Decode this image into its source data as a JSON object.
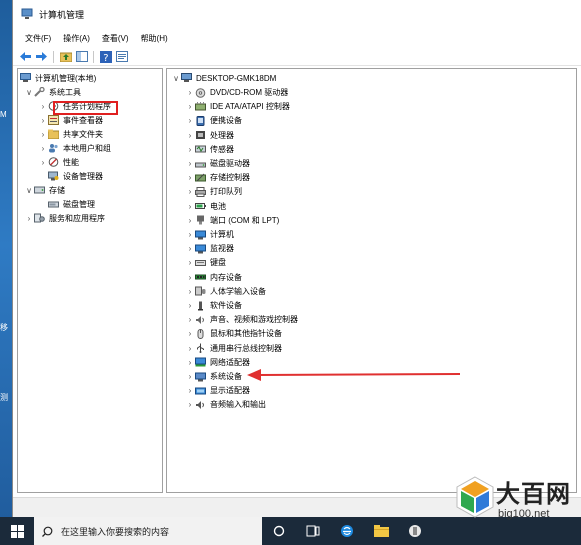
{
  "window": {
    "title": "计算机管理"
  },
  "menu": [
    "文件(F)",
    "操作(A)",
    "查看(V)",
    "帮助(H)"
  ],
  "left_tree": [
    {
      "label": "计算机管理(本地)",
      "indent": 0,
      "expander": "",
      "icon": "computer-management-icon"
    },
    {
      "label": "系统工具",
      "indent": 1,
      "expander": "∨",
      "icon": "tools-icon"
    },
    {
      "label": "任务计划程序",
      "indent": 2,
      "expander": "›",
      "icon": "clock-icon"
    },
    {
      "label": "事件查看器",
      "indent": 2,
      "expander": "›",
      "icon": "event-viewer-icon"
    },
    {
      "label": "共享文件夹",
      "indent": 2,
      "expander": "›",
      "icon": "shared-folder-icon"
    },
    {
      "label": "本地用户和组",
      "indent": 2,
      "expander": "›",
      "icon": "users-icon"
    },
    {
      "label": "性能",
      "indent": 2,
      "expander": "›",
      "icon": "performance-icon"
    },
    {
      "label": "设备管理器",
      "indent": 2,
      "expander": "",
      "icon": "device-manager-icon"
    },
    {
      "label": "存储",
      "indent": 1,
      "expander": "∨",
      "icon": "storage-icon"
    },
    {
      "label": "磁盘管理",
      "indent": 2,
      "expander": "",
      "icon": "disk-management-icon"
    },
    {
      "label": "服务和应用程序",
      "indent": 1,
      "expander": "›",
      "icon": "services-icon"
    }
  ],
  "device_tree": {
    "root": "DESKTOP-GMK18DM",
    "items": [
      {
        "label": "DVD/CD-ROM 驱动器",
        "icon": "dvd-icon"
      },
      {
        "label": "IDE ATA/ATAPI 控制器",
        "icon": "ide-controller-icon"
      },
      {
        "label": "便携设备",
        "icon": "portable-device-icon"
      },
      {
        "label": "处理器",
        "icon": "processor-icon"
      },
      {
        "label": "传感器",
        "icon": "sensor-icon"
      },
      {
        "label": "磁盘驱动器",
        "icon": "disk-drive-icon"
      },
      {
        "label": "存储控制器",
        "icon": "storage-controller-icon"
      },
      {
        "label": "打印队列",
        "icon": "printer-icon"
      },
      {
        "label": "电池",
        "icon": "battery-icon"
      },
      {
        "label": "端口 (COM 和 LPT)",
        "icon": "port-icon"
      },
      {
        "label": "计算机",
        "icon": "computer-icon"
      },
      {
        "label": "监视器",
        "icon": "monitor-icon"
      },
      {
        "label": "键盘",
        "icon": "keyboard-icon"
      },
      {
        "label": "内存设备",
        "icon": "memory-icon"
      },
      {
        "label": "人体学输入设备",
        "icon": "hid-icon"
      },
      {
        "label": "软件设备",
        "icon": "software-device-icon"
      },
      {
        "label": "声音、视频和游戏控制器",
        "icon": "sound-icon"
      },
      {
        "label": "鼠标和其他指针设备",
        "icon": "mouse-icon"
      },
      {
        "label": "通用串行总线控制器",
        "icon": "usb-icon"
      },
      {
        "label": "网络适配器",
        "icon": "network-adapter-icon"
      },
      {
        "label": "系统设备",
        "icon": "system-device-icon"
      },
      {
        "label": "显示适配器",
        "icon": "display-adapter-icon"
      },
      {
        "label": "音频输入和输出",
        "icon": "audio-io-icon"
      }
    ]
  },
  "taskbar": {
    "search_placeholder": "在这里输入你要搜索的内容"
  },
  "desktop_labels": [
    "M",
    "移",
    "测"
  ],
  "watermark": {
    "title": "大百网",
    "url": "big100.net"
  },
  "colors": {
    "highlight": "#e02020",
    "arrow": "#e03030",
    "taskbar": "#1b2a3a"
  }
}
